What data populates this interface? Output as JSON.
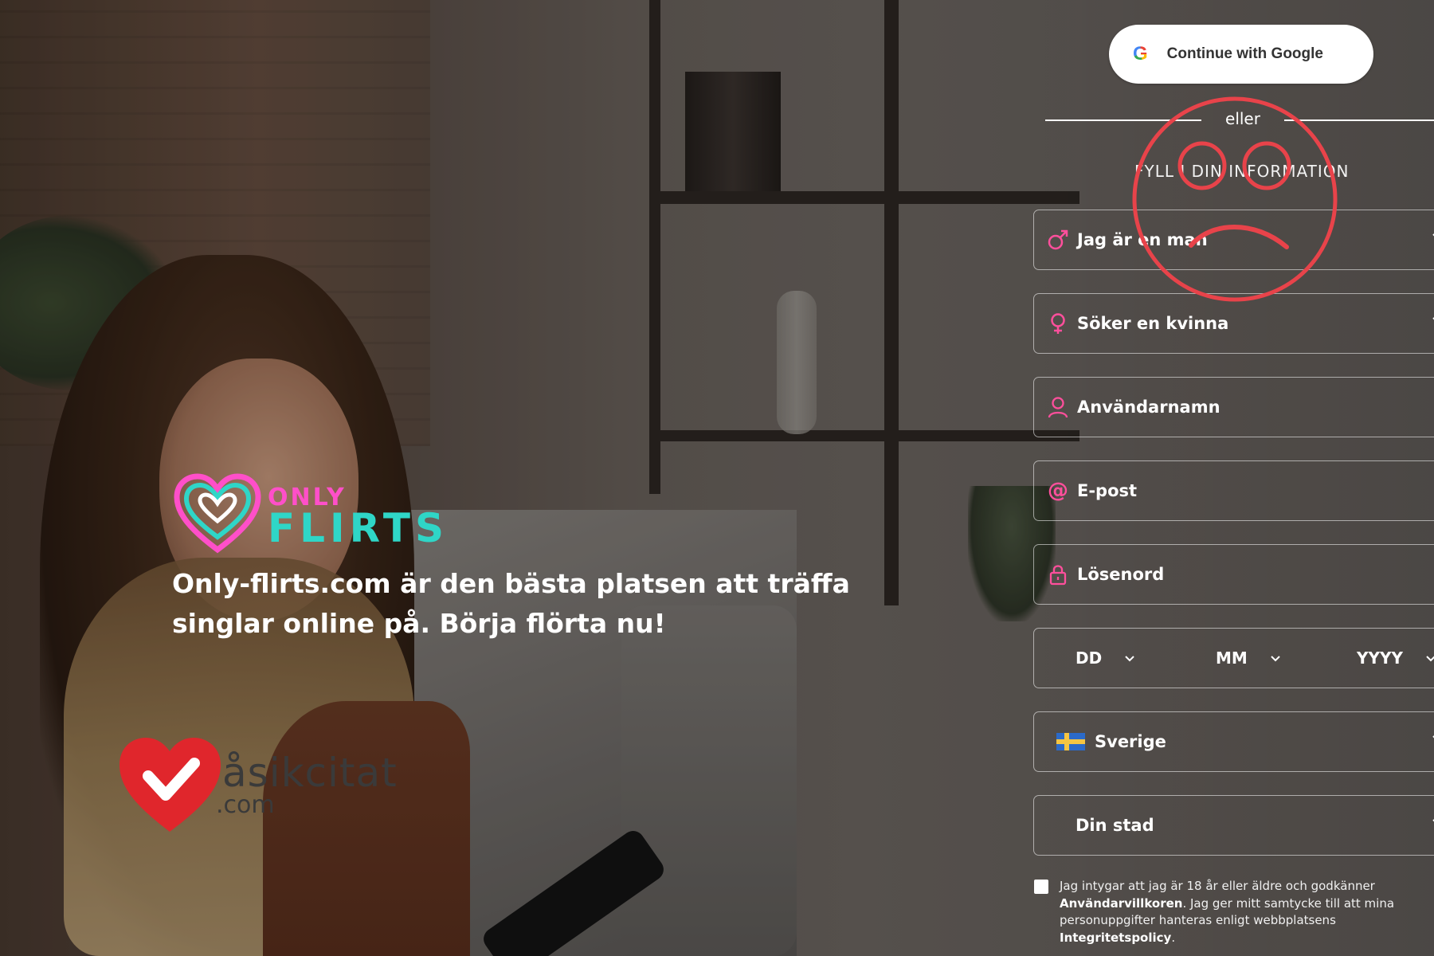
{
  "google": {
    "label": "Continue with Google",
    "icon": "google-g-icon",
    "glyph": "G"
  },
  "divider": {
    "or_text": "eller"
  },
  "form": {
    "section_title": "FYLL I DIN INFORMATION",
    "gender": {
      "value": "Jag är en man",
      "icon": "male-symbol-icon"
    },
    "seeking": {
      "value": "Söker en kvinna",
      "icon": "female-symbol-icon"
    },
    "username": {
      "placeholder": "Användarnamn",
      "icon": "user-icon"
    },
    "email": {
      "placeholder": "E-post",
      "icon": "at-sign-icon"
    },
    "password": {
      "placeholder": "Lösenord",
      "icon": "lock-icon"
    },
    "dob": {
      "day": "DD",
      "month": "MM",
      "year": "YYYY"
    },
    "country": {
      "value": "Sverige",
      "icon": "sweden-flag-icon"
    },
    "city": {
      "placeholder": "Din stad"
    },
    "consent": {
      "text_1": "Jag intygar att jag är 18 år eller äldre och godkänner",
      "terms_link": "Användarvillkoren",
      "text_2": ". Jag ger mitt samtycke till att mina personuppgifter hanteras enligt webbplatsens",
      "privacy_link": "Integritetspolicy",
      "text_3": "."
    }
  },
  "brand": {
    "only": "ONLY",
    "flirts": "FLIRTS",
    "tagline_1": "Only-flirts.com är den bästa platsen att träffa",
    "tagline_2": "singlar online på. Börja flörta nu!"
  },
  "watermark": {
    "name": "åsikcitat",
    "domain": ".com"
  },
  "colors": {
    "accent_pink": "#ff4fc9",
    "accent_teal": "#2fd6c7",
    "icon_pink": "#ff4f9c",
    "sad_face": "#e8434a",
    "watermark_red": "#e0262c"
  }
}
